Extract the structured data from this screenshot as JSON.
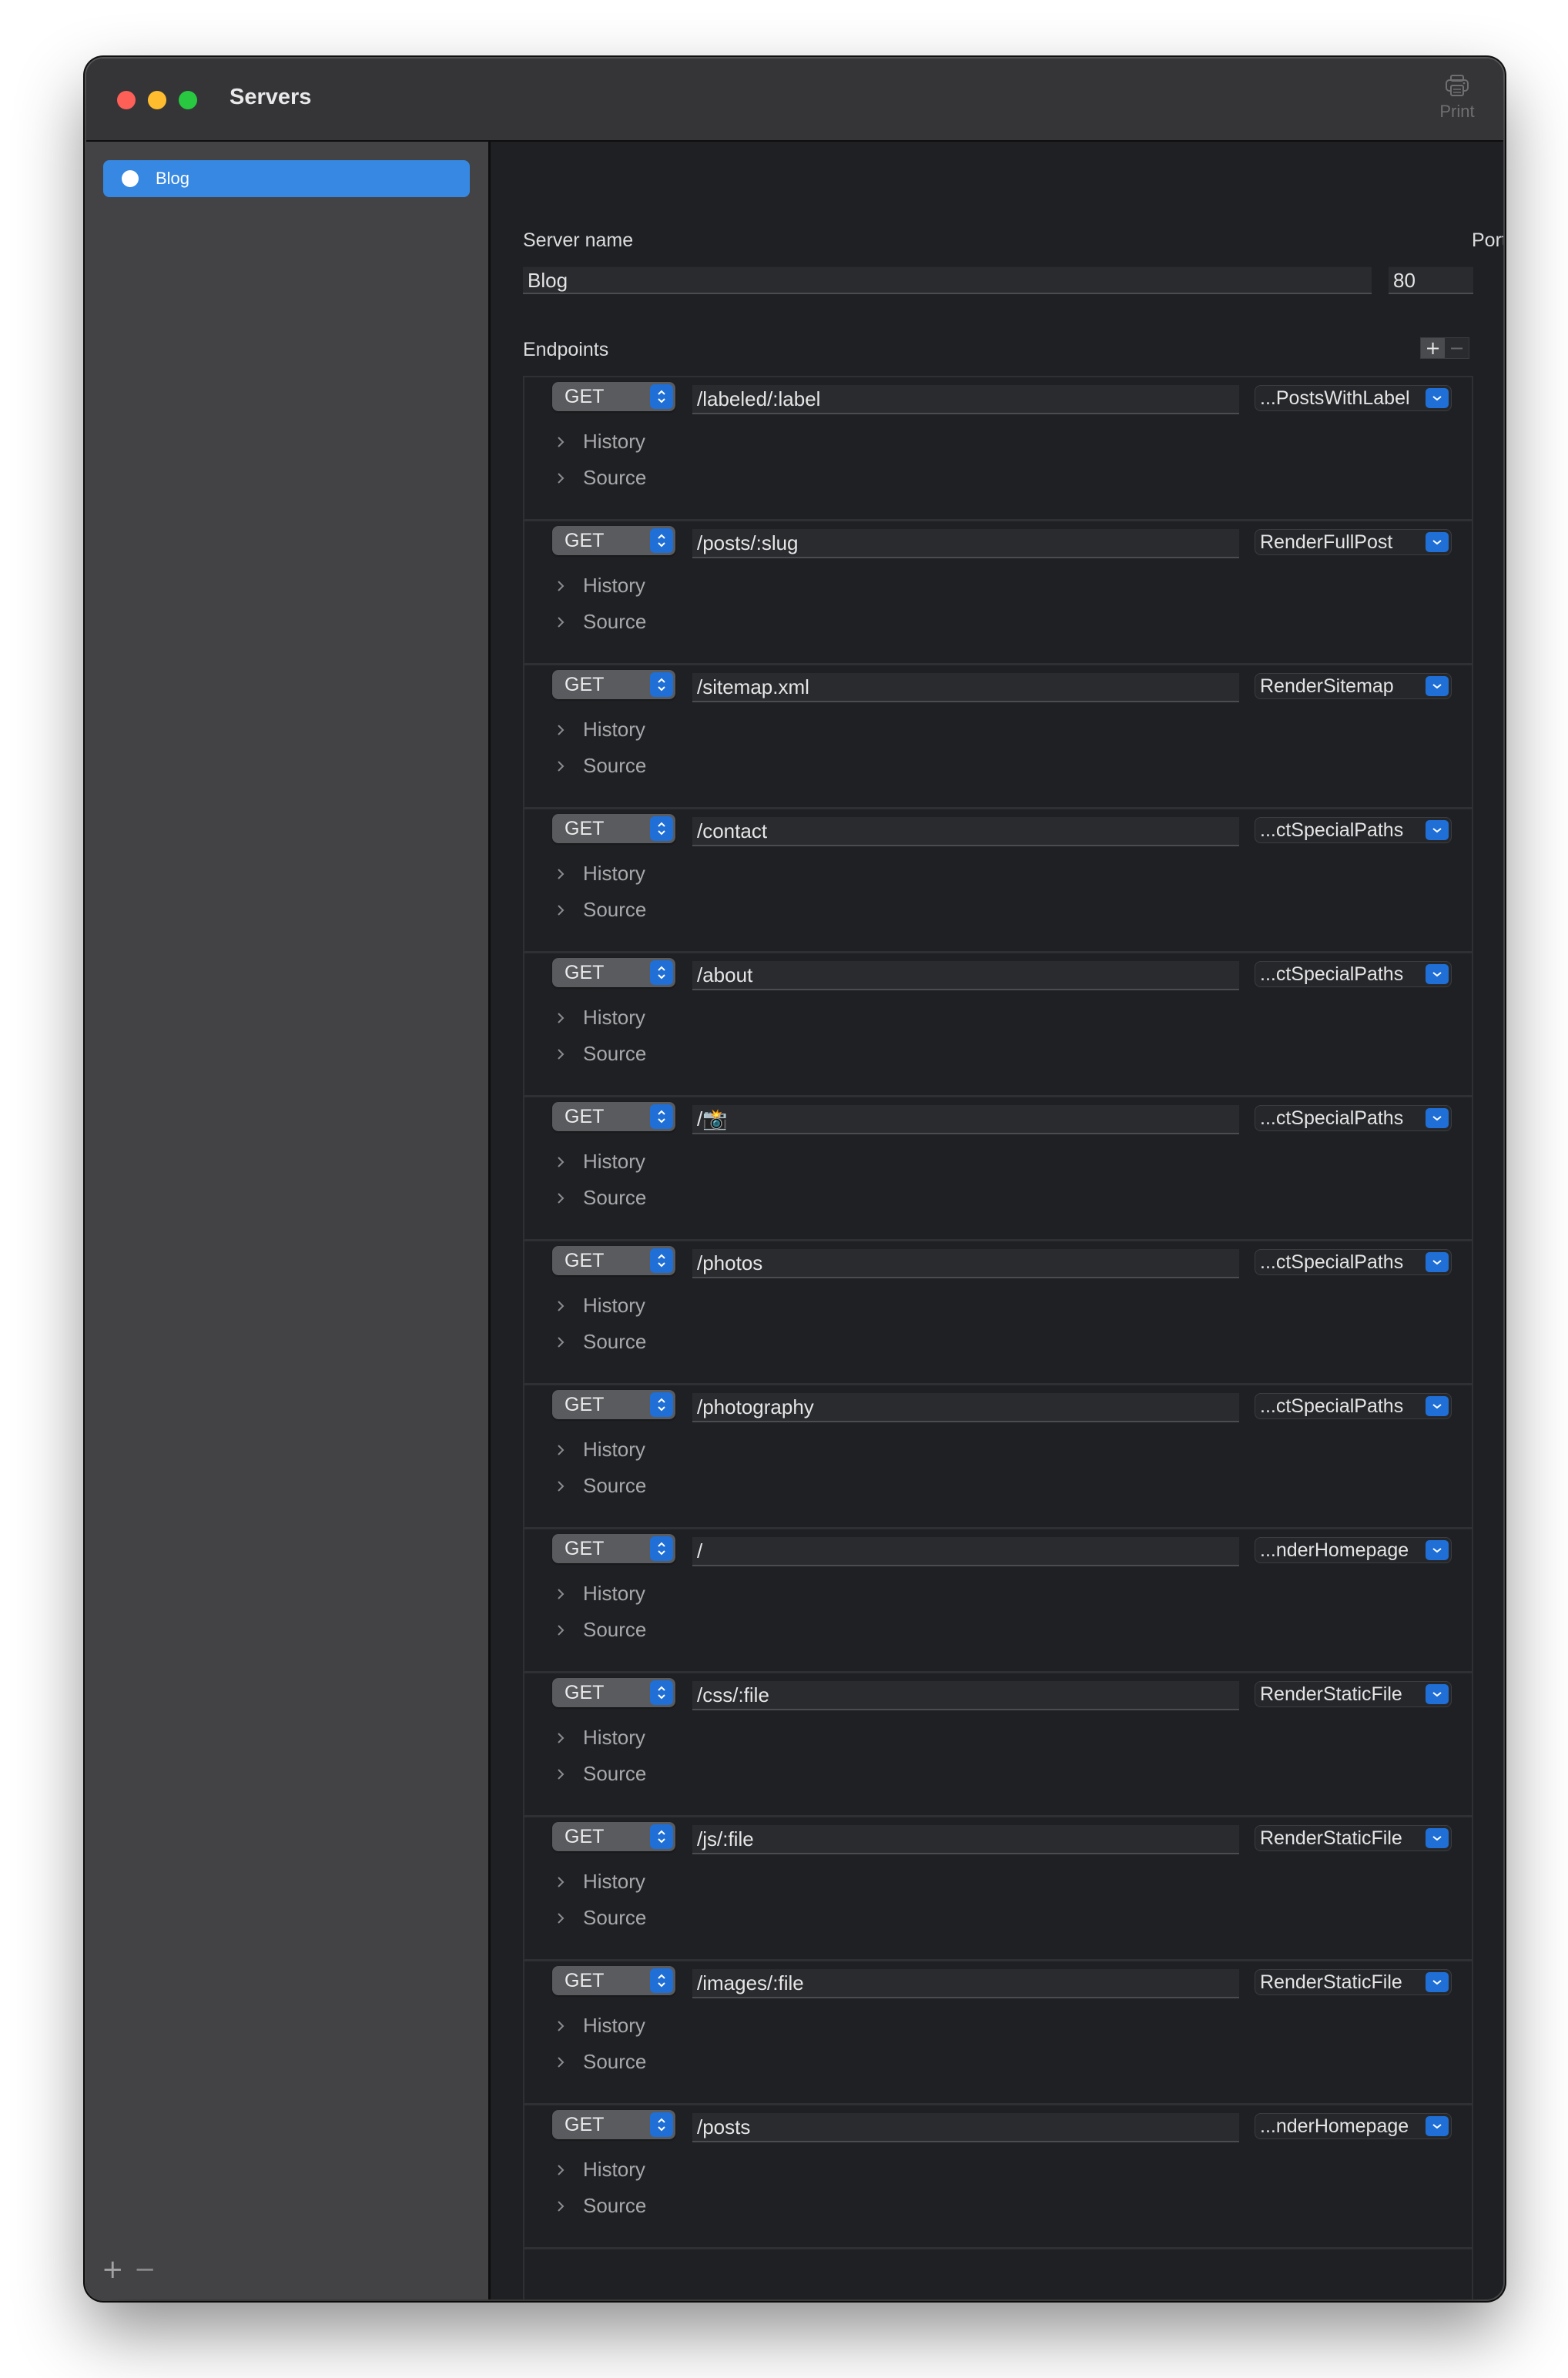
{
  "window": {
    "title": "Servers",
    "toolbar": {
      "print_label": "Print",
      "print_icon": "printer-icon"
    },
    "traffic_lights": {
      "close": "#fe5f57",
      "minimize": "#febc2e",
      "zoom": "#28c840"
    }
  },
  "sidebar": {
    "items": [
      {
        "label": "Blog",
        "selected": true,
        "icon": "status-dot-icon"
      }
    ],
    "add_label": "+",
    "remove_label": "−",
    "accent": "#3688e2"
  },
  "server": {
    "name_label": "Server name",
    "name_value": "Blog",
    "port_label": "Port",
    "port_value": "80"
  },
  "endpoints": {
    "label": "Endpoints",
    "add_label": "+",
    "remove_label": "−",
    "disclosure_labels": {
      "history": "History",
      "source": "Source"
    },
    "rows": [
      {
        "method": "GET",
        "path": "/labeled/:label",
        "handler": "...PostsWithLabel"
      },
      {
        "method": "GET",
        "path": "/posts/:slug",
        "handler": "RenderFullPost"
      },
      {
        "method": "GET",
        "path": "/sitemap.xml",
        "handler": "RenderSitemap"
      },
      {
        "method": "GET",
        "path": "/contact",
        "handler": "...ctSpecialPaths"
      },
      {
        "method": "GET",
        "path": "/about",
        "handler": "...ctSpecialPaths"
      },
      {
        "method": "GET",
        "path": "/📸",
        "handler": "...ctSpecialPaths"
      },
      {
        "method": "GET",
        "path": "/photos",
        "handler": "...ctSpecialPaths"
      },
      {
        "method": "GET",
        "path": "/photography",
        "handler": "...ctSpecialPaths"
      },
      {
        "method": "GET",
        "path": "/",
        "handler": "...nderHomepage"
      },
      {
        "method": "GET",
        "path": "/css/:file",
        "handler": "RenderStaticFile"
      },
      {
        "method": "GET",
        "path": "/js/:file",
        "handler": "RenderStaticFile"
      },
      {
        "method": "GET",
        "path": "/images/:file",
        "handler": "RenderStaticFile"
      },
      {
        "method": "GET",
        "path": "/posts",
        "handler": "...nderHomepage"
      }
    ]
  }
}
